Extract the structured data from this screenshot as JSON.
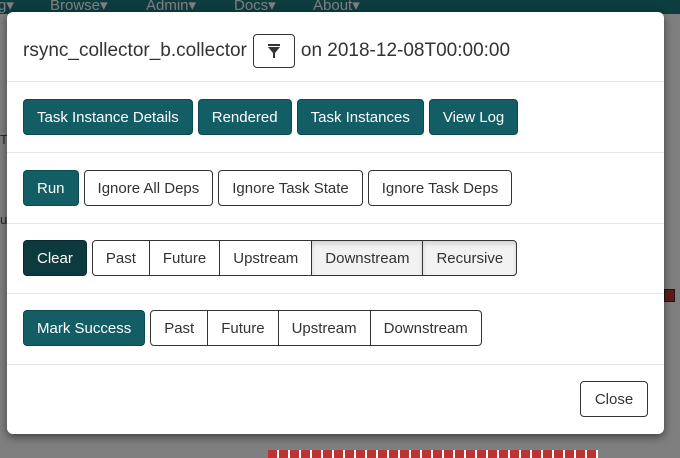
{
  "navbar": {
    "items": [
      "g▾",
      "Browse▾",
      "Admin▾",
      "Docs▾",
      "About▾"
    ]
  },
  "modal": {
    "title_task": "rsync_collector_b.collector",
    "title_date": "on 2018-12-08T00:00:00",
    "filter_icon": "filter-icon",
    "nav_buttons": [
      "Task Instance Details",
      "Rendered",
      "Task Instances",
      "View Log"
    ],
    "run": {
      "label": "Run",
      "options": [
        "Ignore All Deps",
        "Ignore Task State",
        "Ignore Task Deps"
      ]
    },
    "clear": {
      "label": "Clear",
      "options": [
        "Past",
        "Future",
        "Upstream",
        "Downstream",
        "Recursive"
      ],
      "active": [
        "Downstream",
        "Recursive"
      ]
    },
    "mark_success": {
      "label": "Mark Success",
      "options": [
        "Past",
        "Future",
        "Upstream",
        "Downstream"
      ]
    },
    "close_label": "Close"
  },
  "colors": {
    "primary": "#135d64",
    "clear_dark": "#0c3a3e",
    "navbar": "#1b7a7f"
  }
}
